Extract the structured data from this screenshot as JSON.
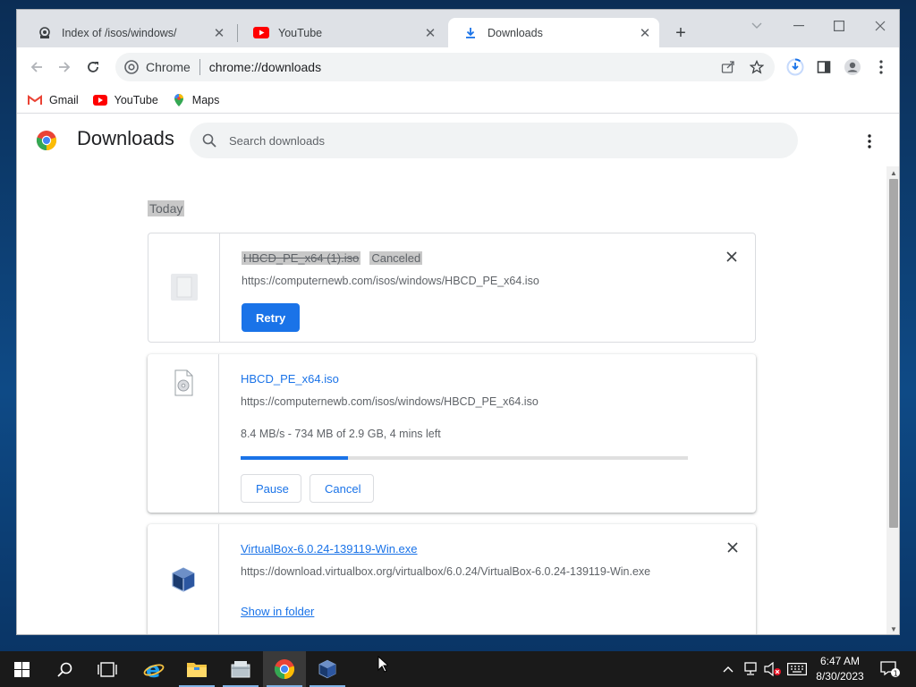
{
  "tabs": [
    {
      "title": "Index of /isos/windows/",
      "icon": "page-icon",
      "active": false
    },
    {
      "title": "YouTube",
      "icon": "youtube-icon",
      "active": false
    },
    {
      "title": "Downloads",
      "icon": "download-icon",
      "active": true
    }
  ],
  "omnibox": {
    "chip": "Chrome",
    "url": "chrome://downloads"
  },
  "bookmarks": [
    {
      "label": "Gmail",
      "icon": "gmail-icon"
    },
    {
      "label": "YouTube",
      "icon": "youtube-icon"
    },
    {
      "label": "Maps",
      "icon": "maps-icon"
    }
  ],
  "page": {
    "title": "Downloads",
    "search_placeholder": "Search downloads",
    "section_label": "Today"
  },
  "downloads": [
    {
      "filename": "HBCD_PE_x64 (1).iso",
      "status": "Canceled",
      "url": "https://computernewb.com/isos/windows/HBCD_PE_x64.iso",
      "action": "Retry"
    },
    {
      "filename": "HBCD_PE_x64.iso",
      "url": "https://computernewb.com/isos/windows/HBCD_PE_x64.iso",
      "progress_text": "8.4 MB/s - 734 MB of 2.9 GB, 4 mins left",
      "progress_fraction": 0.24,
      "actions": [
        "Pause",
        "Cancel"
      ]
    },
    {
      "filename": "VirtualBox-6.0.24-139119-Win.exe",
      "url": "https://download.virtualbox.org/virtualbox/6.0.24/VirtualBox-6.0.24-139119-Win.exe",
      "action": "Show in folder"
    }
  ],
  "taskbar": {
    "apps": [
      "start-icon",
      "search-icon",
      "task-view-icon",
      "internet-explorer-icon",
      "file-explorer-icon",
      "file-manager-icon",
      "chrome-icon",
      "virtualbox-icon"
    ],
    "time": "6:47 AM",
    "date": "8/30/2023",
    "notification_count": "1"
  },
  "colors": {
    "accent": "#1a73e8",
    "taskbar": "#1a1a1a"
  }
}
